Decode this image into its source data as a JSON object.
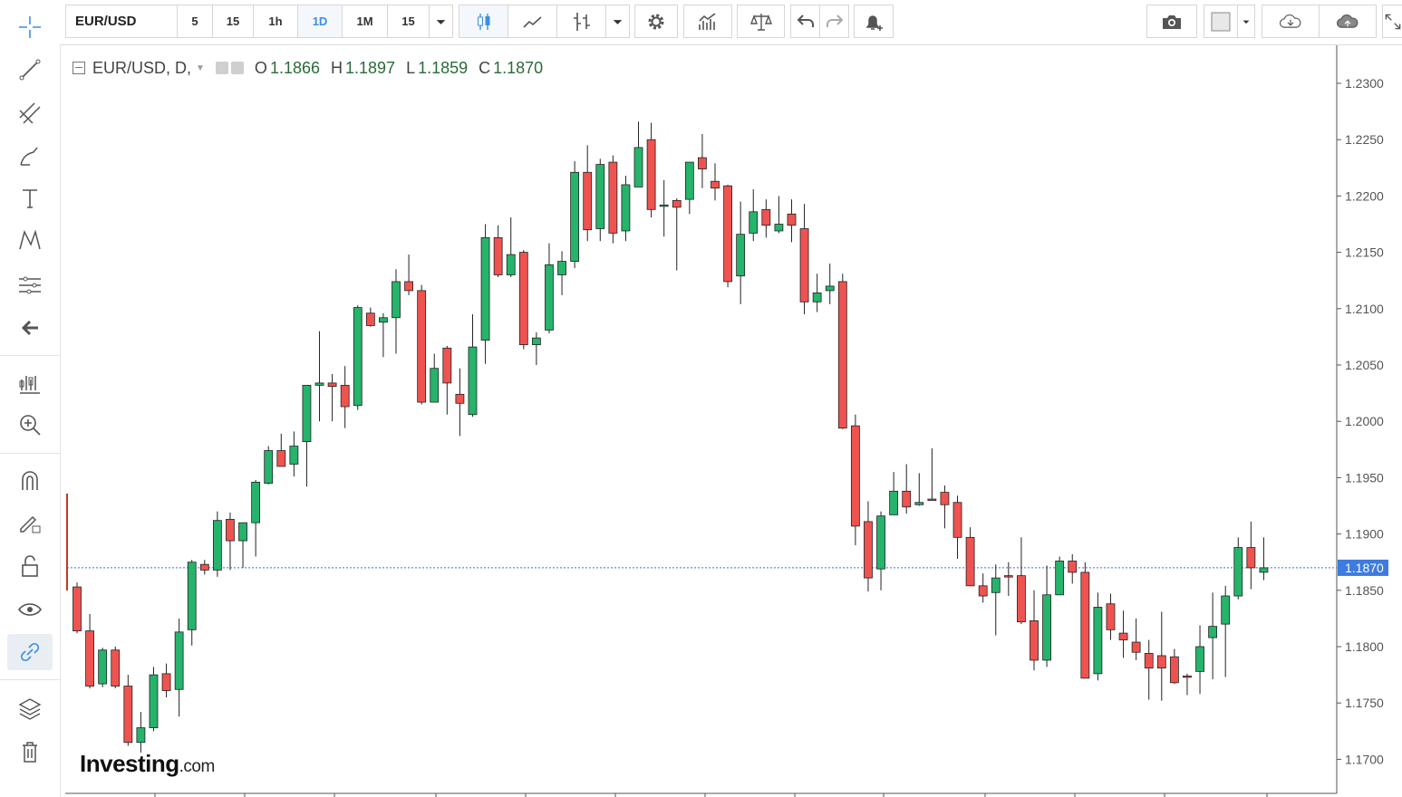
{
  "toolbar": {
    "symbol": "EUR/USD",
    "intervals": [
      "5",
      "15",
      "1h",
      "1D",
      "1M",
      "15"
    ],
    "selected_interval": "1D"
  },
  "legend": {
    "title": "EUR/USD, D,",
    "open_label": "O",
    "open": "1.1866",
    "high_label": "H",
    "high": "1.1897",
    "low_label": "L",
    "low": "1.1859",
    "close_label": "C",
    "close": "1.1870"
  },
  "branding": {
    "logo_main": "Investing",
    "logo_suffix": ".com"
  },
  "colors": {
    "up": "#26b36b",
    "down": "#ef5350",
    "price_tag": "#3d7be0",
    "accent": "#3c8ee6"
  },
  "icons": {
    "left_toolbar": [
      "crosshair-icon",
      "trend-line-icon",
      "fib-icon",
      "brush-icon",
      "text-icon",
      "pattern-icon",
      "measure-icon",
      "back-arrow-icon",
      "long-short-icon",
      "zoom-in-icon",
      "magnet-icon",
      "lock-drawing-icon",
      "lock-icon",
      "eye-icon",
      "link-icon",
      "layers-icon",
      "trash-icon"
    ],
    "top_toolbar": [
      "candles-icon",
      "line-chart-icon",
      "bars-icon",
      "settings-icon",
      "indicators-icon",
      "compare-icon",
      "undo-icon",
      "redo-icon",
      "alert-icon",
      "camera-icon",
      "color-swatch-icon",
      "cloud-download-icon",
      "cloud-upload-icon",
      "fullscreen-icon"
    ]
  },
  "chart_data": {
    "type": "candlestick",
    "y_ticks": [
      "1.2300",
      "1.2250",
      "1.2200",
      "1.2150",
      "1.2100",
      "1.2050",
      "1.2000",
      "1.1950",
      "1.1900",
      "1.1850",
      "1.1800",
      "1.1750",
      "1.1700"
    ],
    "ylim": [
      1.168,
      1.2335
    ],
    "last_price": "1.1870",
    "candles": [
      [
        1.1853,
        1.1857,
        1.1812,
        1.1814
      ],
      [
        1.1814,
        1.1829,
        1.1763,
        1.1765
      ],
      [
        1.1767,
        1.1799,
        1.1764,
        1.1797
      ],
      [
        1.1797,
        1.18,
        1.1763,
        1.1765
      ],
      [
        1.1765,
        1.1775,
        1.1712,
        1.1715
      ],
      [
        1.1715,
        1.1742,
        1.1706,
        1.1728
      ],
      [
        1.1728,
        1.1782,
        1.1725,
        1.1775
      ],
      [
        1.1776,
        1.1785,
        1.1755,
        1.1761
      ],
      [
        1.1762,
        1.1825,
        1.1738,
        1.1813
      ],
      [
        1.1815,
        1.1877,
        1.1801,
        1.1875
      ],
      [
        1.1873,
        1.1877,
        1.1864,
        1.1868
      ],
      [
        1.1868,
        1.192,
        1.1862,
        1.1912
      ],
      [
        1.1913,
        1.1919,
        1.1868,
        1.1894
      ],
      [
        1.1894,
        1.1904,
        1.187,
        1.191
      ],
      [
        1.191,
        1.1948,
        1.188,
        1.1946
      ],
      [
        1.1945,
        1.1978,
        1.1944,
        1.1974
      ],
      [
        1.1974,
        1.1989,
        1.196,
        1.196
      ],
      [
        1.1962,
        1.1991,
        1.1951,
        1.1978
      ],
      [
        1.1982,
        1.2003,
        1.1942,
        1.2032
      ],
      [
        1.2032,
        1.208,
        1.2,
        1.2034
      ],
      [
        1.2034,
        1.2042,
        1.2,
        1.2031
      ],
      [
        1.2032,
        1.2049,
        1.1994,
        1.2013
      ],
      [
        1.2014,
        1.2103,
        1.201,
        1.2101
      ],
      [
        1.2096,
        1.2101,
        1.2084,
        1.2085
      ],
      [
        1.2088,
        1.2096,
        1.2057,
        1.2092
      ],
      [
        1.2092,
        1.2135,
        1.206,
        1.2124
      ],
      [
        1.2124,
        1.2148,
        1.2112,
        1.2116
      ],
      [
        1.2116,
        1.2121,
        1.2015,
        1.2017
      ],
      [
        1.2017,
        1.206,
        1.2027,
        1.2047
      ],
      [
        1.2065,
        1.2067,
        1.2006,
        1.2034
      ],
      [
        1.2024,
        1.2047,
        1.1987,
        1.2016
      ],
      [
        1.2006,
        1.2095,
        1.2004,
        1.2066
      ],
      [
        1.2072,
        1.2175,
        1.2051,
        1.2163
      ],
      [
        1.2163,
        1.2174,
        1.2128,
        1.213
      ],
      [
        1.213,
        1.2181,
        1.2128,
        1.2148
      ],
      [
        1.215,
        1.2152,
        1.2064,
        1.2068
      ],
      [
        1.2068,
        1.2079,
        1.205,
        1.2074
      ],
      [
        1.2081,
        1.2158,
        1.2078,
        1.2139
      ],
      [
        1.213,
        1.2151,
        1.2112,
        1.2142
      ],
      [
        1.2142,
        1.2231,
        1.2136,
        1.2221
      ],
      [
        1.2221,
        1.2245,
        1.216,
        1.217
      ],
      [
        1.2171,
        1.2233,
        1.216,
        1.2228
      ],
      [
        1.223,
        1.2236,
        1.2158,
        1.2167
      ],
      [
        1.2169,
        1.2218,
        1.216,
        1.221
      ],
      [
        1.2208,
        1.2266,
        1.2212,
        1.2243
      ],
      [
        1.225,
        1.2265,
        1.2181,
        1.2188
      ],
      [
        1.2192,
        1.2214,
        1.2164,
        1.2192
      ],
      [
        1.2196,
        1.2198,
        1.2134,
        1.219
      ],
      [
        1.2197,
        1.2225,
        1.2184,
        1.223
      ],
      [
        1.2234,
        1.2255,
        1.2207,
        1.2224
      ],
      [
        1.2213,
        1.2229,
        1.2196,
        1.2207
      ],
      [
        1.2209,
        1.221,
        1.2119,
        1.2124
      ],
      [
        1.2129,
        1.2195,
        1.2104,
        1.2166
      ],
      [
        1.2167,
        1.2206,
        1.216,
        1.2186
      ],
      [
        1.2188,
        1.2197,
        1.2163,
        1.2174
      ],
      [
        1.2169,
        1.22,
        1.2167,
        1.2175
      ],
      [
        1.2184,
        1.2197,
        1.2159,
        1.2174
      ],
      [
        1.2171,
        1.2193,
        1.2095,
        1.2106
      ],
      [
        1.2106,
        1.2131,
        1.2097,
        1.2114
      ],
      [
        1.2116,
        1.214,
        1.2104,
        1.212
      ],
      [
        1.2124,
        1.2131,
        1.1993,
        1.1994
      ],
      [
        1.1996,
        1.2006,
        1.189,
        1.1907
      ],
      [
        1.1911,
        1.1929,
        1.1849,
        1.1861
      ],
      [
        1.1869,
        1.192,
        1.185,
        1.1916
      ],
      [
        1.1917,
        1.1955,
        1.1917,
        1.1938
      ],
      [
        1.1938,
        1.1962,
        1.1918,
        1.1924
      ],
      [
        1.1926,
        1.1954,
        1.1925,
        1.1928
      ],
      [
        1.1931,
        1.1976,
        1.1931,
        1.193
      ],
      [
        1.1937,
        1.1943,
        1.1905,
        1.1926
      ],
      [
        1.1928,
        1.1934,
        1.1878,
        1.1897
      ],
      [
        1.1897,
        1.1906,
        1.1854,
        1.1854
      ],
      [
        1.1854,
        1.1865,
        1.1839,
        1.1845
      ],
      [
        1.1848,
        1.1873,
        1.181,
        1.1861
      ],
      [
        1.1863,
        1.1875,
        1.1845,
        1.1862
      ],
      [
        1.1863,
        1.1897,
        1.182,
        1.1822
      ],
      [
        1.1823,
        1.185,
        1.1779,
        1.1788
      ],
      [
        1.1788,
        1.1872,
        1.1782,
        1.1846
      ],
      [
        1.1846,
        1.188,
        1.1849,
        1.1876
      ],
      [
        1.1876,
        1.1882,
        1.1856,
        1.1866
      ],
      [
        1.1866,
        1.1875,
        1.1772,
        1.1772
      ],
      [
        1.1776,
        1.1848,
        1.177,
        1.1835
      ],
      [
        1.1838,
        1.1847,
        1.1806,
        1.1815
      ],
      [
        1.1812,
        1.1832,
        1.179,
        1.1806
      ],
      [
        1.1804,
        1.1825,
        1.1788,
        1.1795
      ],
      [
        1.1794,
        1.1806,
        1.1753,
        1.1781
      ],
      [
        1.1792,
        1.1831,
        1.1752,
        1.1781
      ],
      [
        1.1791,
        1.1798,
        1.1767,
        1.1768
      ],
      [
        1.1774,
        1.1776,
        1.1757,
        1.1773
      ],
      [
        1.1778,
        1.1819,
        1.1758,
        1.18
      ],
      [
        1.1808,
        1.1848,
        1.1771,
        1.1818
      ],
      [
        1.182,
        1.1854,
        1.1773,
        1.1845
      ],
      [
        1.1845,
        1.1897,
        1.1842,
        1.1888
      ],
      [
        1.1888,
        1.1911,
        1.1851,
        1.187
      ],
      [
        1.1866,
        1.1897,
        1.1859,
        1.187
      ]
    ]
  }
}
